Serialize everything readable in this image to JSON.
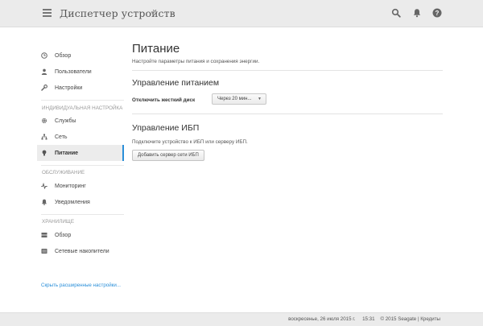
{
  "header": {
    "app_title": "Диспетчер устройств",
    "icons": [
      "menu-icon",
      "search-icon",
      "bell-icon",
      "help-icon"
    ]
  },
  "sidebar": {
    "items_top": [
      {
        "label": "Обзор",
        "icon": "clock-icon"
      },
      {
        "label": "Пользователи",
        "icon": "user-icon"
      },
      {
        "label": "Настройки",
        "icon": "wrench-icon"
      }
    ],
    "section_custom": "ИНДИВИДУАЛЬНАЯ НАСТРОЙКА",
    "items_custom": [
      {
        "label": "Службы",
        "icon": "gear-icon"
      },
      {
        "label": "Сеть",
        "icon": "network-icon"
      },
      {
        "label": "Питание",
        "icon": "bulb-icon",
        "active": true
      }
    ],
    "section_service": "ОБСЛУЖИВАНИЕ",
    "items_service": [
      {
        "label": "Мониторинг",
        "icon": "pulse-icon"
      },
      {
        "label": "Уведомления",
        "icon": "bell-icon"
      }
    ],
    "section_storage": "ХРАНИЛИЩЕ",
    "items_storage": [
      {
        "label": "Обзор",
        "icon": "storage-icon"
      },
      {
        "label": "Сетевые накопители",
        "icon": "nas-icon"
      }
    ],
    "hide_link": "Скрыть расширенные настройки..."
  },
  "main": {
    "title": "Питание",
    "subtitle": "Настройте параметры питания и сохранения энергии.",
    "power_section": {
      "title": "Управление питанием",
      "disk_label": "Отключить жесткий диск",
      "disk_value": "Через 20 мин..."
    },
    "ups_section": {
      "title": "Управление ИБП",
      "text": "Подключите устройство к ИБП или серверу ИБП.",
      "button": "Добавить сервер сети ИБП"
    }
  },
  "footer": {
    "date": "воскресенье, 26 июля 2015 г.",
    "time": "15:31",
    "copyright": "© 2015 Seagate | Кредиты"
  },
  "colors": {
    "accent": "#2a8fd9",
    "topbar_bg": "#ebebeb"
  }
}
